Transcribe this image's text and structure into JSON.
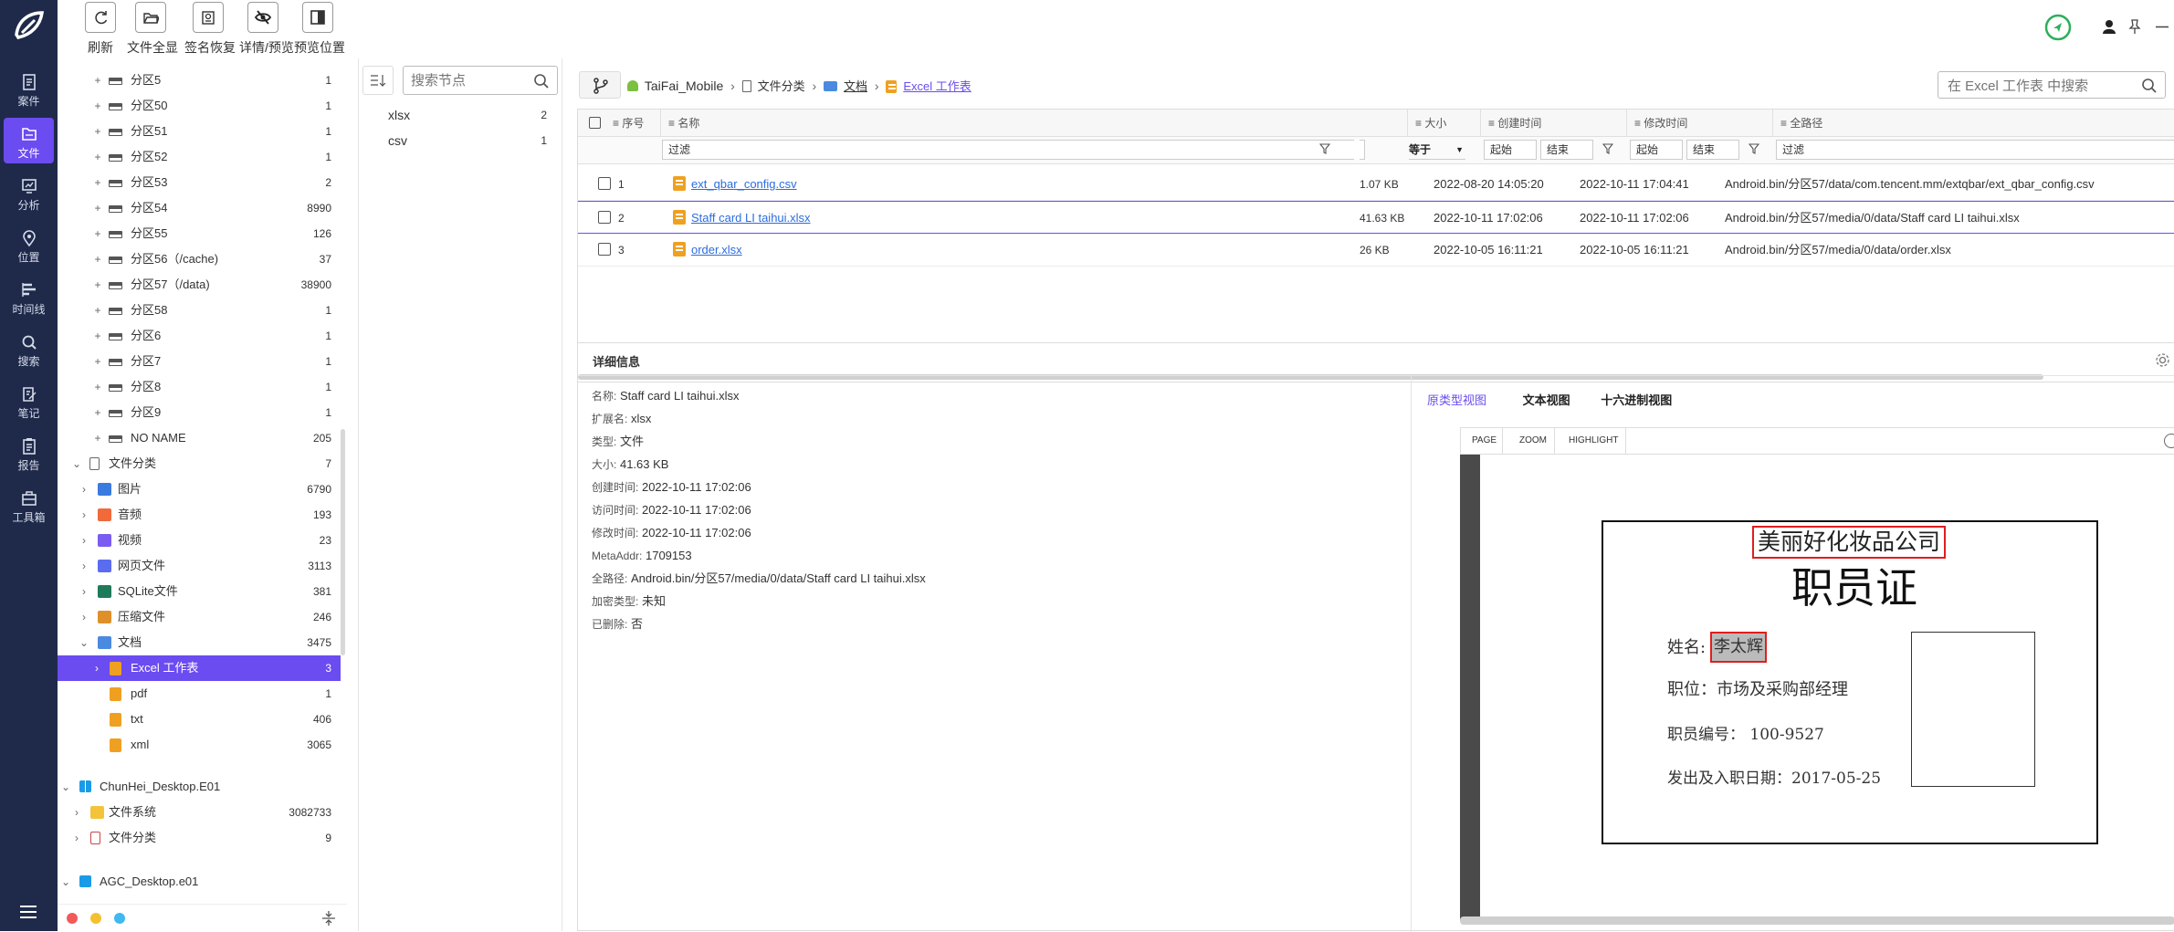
{
  "toolbar": [
    {
      "label": "刷新",
      "icon": "refresh-icon"
    },
    {
      "label": "文件全显",
      "icon": "folder-open-icon"
    },
    {
      "label": "签名恢复",
      "icon": "signature-restore-icon"
    },
    {
      "label": "详情/预览",
      "icon": "eye-off-icon"
    },
    {
      "label": "预览位置",
      "icon": "panel-position-icon"
    }
  ],
  "rail": [
    {
      "label": "案件",
      "icon": "case-icon"
    },
    {
      "label": "文件",
      "icon": "file-icon"
    },
    {
      "label": "分析",
      "icon": "analysis-icon"
    },
    {
      "label": "位置",
      "icon": "location-icon"
    },
    {
      "label": "时间线",
      "icon": "timeline-icon"
    },
    {
      "label": "搜索",
      "icon": "search-icon"
    },
    {
      "label": "笔记",
      "icon": "note-icon"
    },
    {
      "label": "报告",
      "icon": "report-icon"
    },
    {
      "label": "工具箱",
      "icon": "toolbox-icon"
    }
  ],
  "tree": {
    "partitions": [
      {
        "label": "分区5",
        "count": "1"
      },
      {
        "label": "分区50",
        "count": "1"
      },
      {
        "label": "分区51",
        "count": "1"
      },
      {
        "label": "分区52",
        "count": "1"
      },
      {
        "label": "分区53",
        "count": "2"
      },
      {
        "label": "分区54",
        "count": "8990"
      },
      {
        "label": "分区55",
        "count": "126"
      },
      {
        "label": "分区56（/cache)",
        "count": "37"
      },
      {
        "label": "分区57（/data)",
        "count": "38900"
      },
      {
        "label": "分区58",
        "count": "1"
      },
      {
        "label": "分区6",
        "count": "1"
      },
      {
        "label": "分区7",
        "count": "1"
      },
      {
        "label": "分区8",
        "count": "1"
      },
      {
        "label": "分区9",
        "count": "1"
      },
      {
        "label": "NO NAME",
        "count": "205"
      }
    ],
    "category": {
      "label": "文件分类",
      "count": "7"
    },
    "categories": [
      {
        "label": "图片",
        "count": "6790",
        "color": "#3a7be0"
      },
      {
        "label": "音频",
        "count": "193",
        "color": "#f06a3a"
      },
      {
        "label": "视频",
        "count": "23",
        "color": "#7a5cf0"
      },
      {
        "label": "网页文件",
        "count": "3113",
        "color": "#5a6cf0"
      },
      {
        "label": "SQLite文件",
        "count": "381",
        "color": "#1f7a5a"
      },
      {
        "label": "压缩文件",
        "count": "246",
        "color": "#e0902a"
      },
      {
        "label": "文档",
        "count": "3475",
        "color": "#4a8ae0"
      }
    ],
    "docs": [
      {
        "label": "Excel 工作表",
        "count": "3"
      },
      {
        "label": "pdf",
        "count": "1"
      },
      {
        "label": "txt",
        "count": "406"
      },
      {
        "label": "xml",
        "count": "3065"
      }
    ],
    "device2": {
      "label": "ChunHei_Desktop.E01"
    },
    "device2_items": [
      {
        "label": "文件系统",
        "count": "3082733"
      },
      {
        "label": "文件分类",
        "count": "9"
      }
    ],
    "device3": {
      "label": "AGC_Desktop.e01"
    }
  },
  "mid": {
    "search_placeholder": "搜索节点",
    "items": [
      {
        "label": "xlsx",
        "count": "2"
      },
      {
        "label": "csv",
        "count": "1"
      }
    ]
  },
  "breadcrumb": {
    "device": "TaiFai_Mobile",
    "cat": "文件分类",
    "docs": "文档",
    "current": "Excel 工作表"
  },
  "search": {
    "placeholder": "在 Excel 工作表 中搜索"
  },
  "table": {
    "headers": {
      "seq": "序号",
      "name": "名称",
      "size": "大小",
      "created": "创建时间",
      "modified": "修改时间",
      "path": "全路径"
    },
    "filters": {
      "name": "过滤",
      "size_op": "等于",
      "start": "起始",
      "end": "结束",
      "path": "过滤"
    },
    "rows": [
      {
        "seq": "1",
        "name": "ext_qbar_config.csv",
        "size": "1.07 KB",
        "created": "2022-08-20 14:05:20",
        "modified": "2022-10-11 17:04:41",
        "path": "Android.bin/分区57/data/com.tencent.mm/extqbar/ext_qbar_config.csv"
      },
      {
        "seq": "2",
        "name": "Staff card LI taihui.xlsx",
        "size": "41.63 KB",
        "created": "2022-10-11 17:02:06",
        "modified": "2022-10-11 17:02:06",
        "path": "Android.bin/分区57/media/0/data/Staff card LI taihui.xlsx"
      },
      {
        "seq": "3",
        "name": "order.xlsx",
        "size": "26 KB",
        "created": "2022-10-05 16:11:21",
        "modified": "2022-10-05 16:11:21",
        "path": "Android.bin/分区57/media/0/data/order.xlsx"
      }
    ]
  },
  "detail": {
    "title": "详细信息",
    "fields": [
      {
        "k": "名称:",
        "v": "Staff card LI taihui.xlsx"
      },
      {
        "k": "扩展名:",
        "v": "xlsx"
      },
      {
        "k": "类型:",
        "v": "文件"
      },
      {
        "k": "大小:",
        "v": "41.63 KB"
      },
      {
        "k": "创建时间:",
        "v": "2022-10-11 17:02:06"
      },
      {
        "k": "访问时间:",
        "v": "2022-10-11 17:02:06"
      },
      {
        "k": "修改时间:",
        "v": "2022-10-11 17:02:06"
      },
      {
        "k": "MetaAddr:",
        "v": "1709153"
      },
      {
        "k": "全路径:",
        "v": "Android.bin/分区57/media/0/data/Staff card LI taihui.xlsx"
      },
      {
        "k": "加密类型:",
        "v": "未知"
      },
      {
        "k": "已删除:",
        "v": "否"
      }
    ]
  },
  "preview": {
    "tabs": [
      "原类型视图",
      "文本视图",
      "十六进制视图"
    ],
    "buttons": [
      "PAGE",
      "ZOOM",
      "HIGHLIGHT"
    ],
    "card": {
      "company": "美丽好化妆品公司",
      "title": "职员证",
      "name_label": "姓名:",
      "name_value": "李太辉",
      "position": "职位：市场及采购部经理",
      "number": "职员编号： 100-9527",
      "date": "发出及入职日期：2017-05-25"
    }
  },
  "colors": {
    "rail": "#1f2a4a",
    "accent": "#6b4cf0",
    "link": "#2b6de0",
    "highlight": "#e01e1e"
  }
}
